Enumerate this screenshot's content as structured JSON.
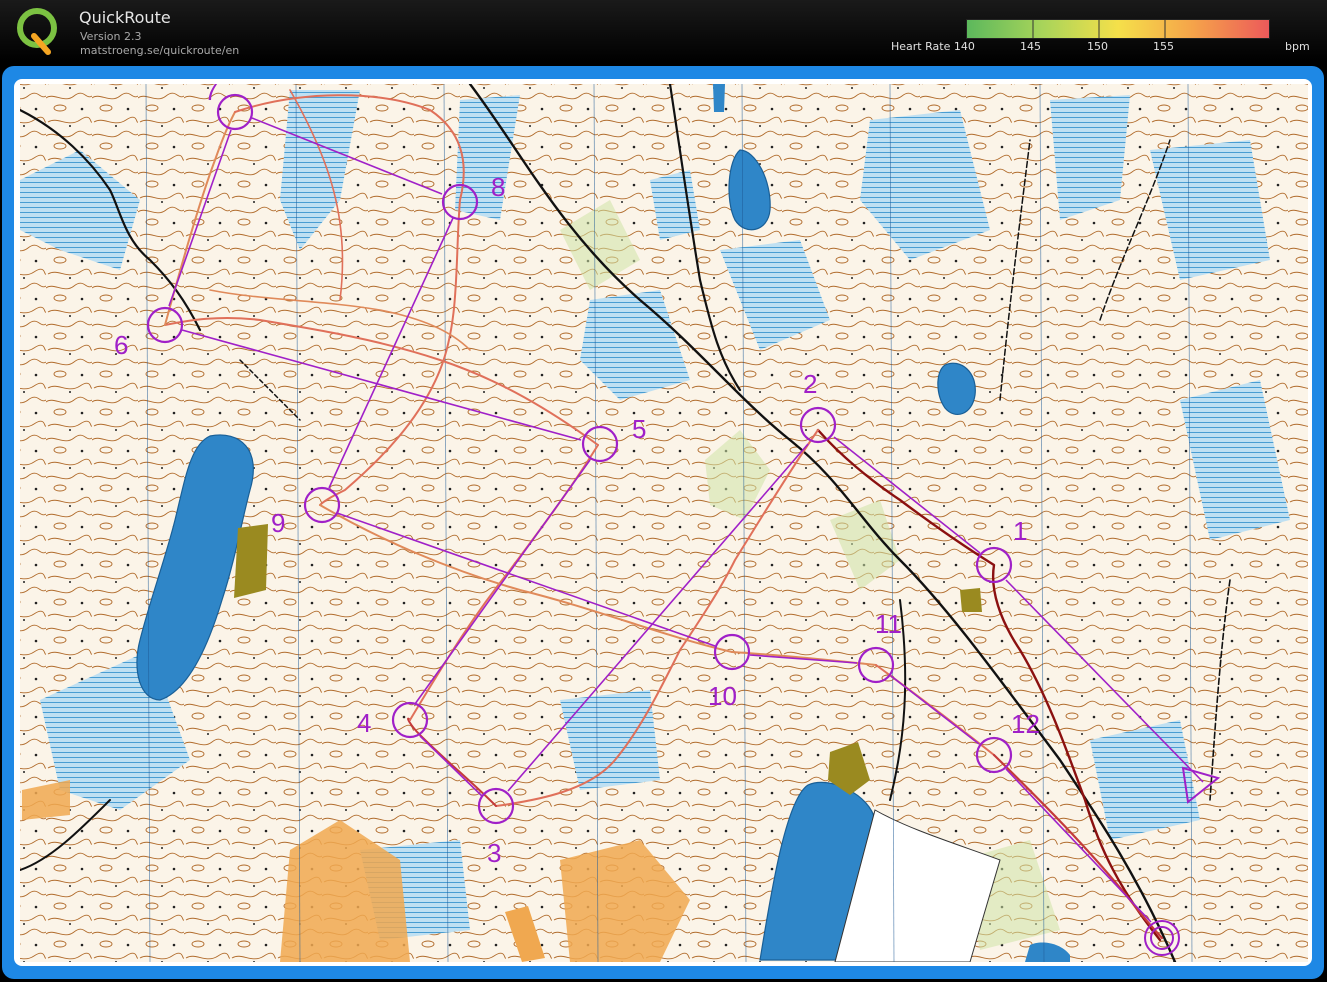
{
  "app": {
    "title": "QuickRoute",
    "version": "Version 2.3",
    "url": "matstroeng.se/quickroute/en",
    "logo_letter": "Q"
  },
  "heart_rate": {
    "label": "Heart Rate",
    "ticks": [
      "140",
      "145",
      "150",
      "155"
    ],
    "unit": "bpm",
    "colors": [
      "#5cb85c",
      "#a8d45a",
      "#f5e04a",
      "#f5a34a",
      "#ec5a5a"
    ]
  },
  "course": {
    "line_color": "#a020c8",
    "controls": [
      {
        "label": "1"
      },
      {
        "label": "2"
      },
      {
        "label": "3"
      },
      {
        "label": "4"
      },
      {
        "label": "5"
      },
      {
        "label": "6"
      },
      {
        "label": "7"
      },
      {
        "label": "8"
      },
      {
        "label": "9"
      },
      {
        "label": "10"
      },
      {
        "label": "11"
      },
      {
        "label": "12"
      }
    ]
  },
  "map": {
    "colors": {
      "terrain": "#fbf4e8",
      "contour": "#b06a2a",
      "water": "#2f86c8",
      "marsh": "#8ec5e8",
      "route": "#e0705a",
      "road": "#111111",
      "yellow_open": "#f0a850",
      "green_veg": "#9a8a20"
    }
  }
}
